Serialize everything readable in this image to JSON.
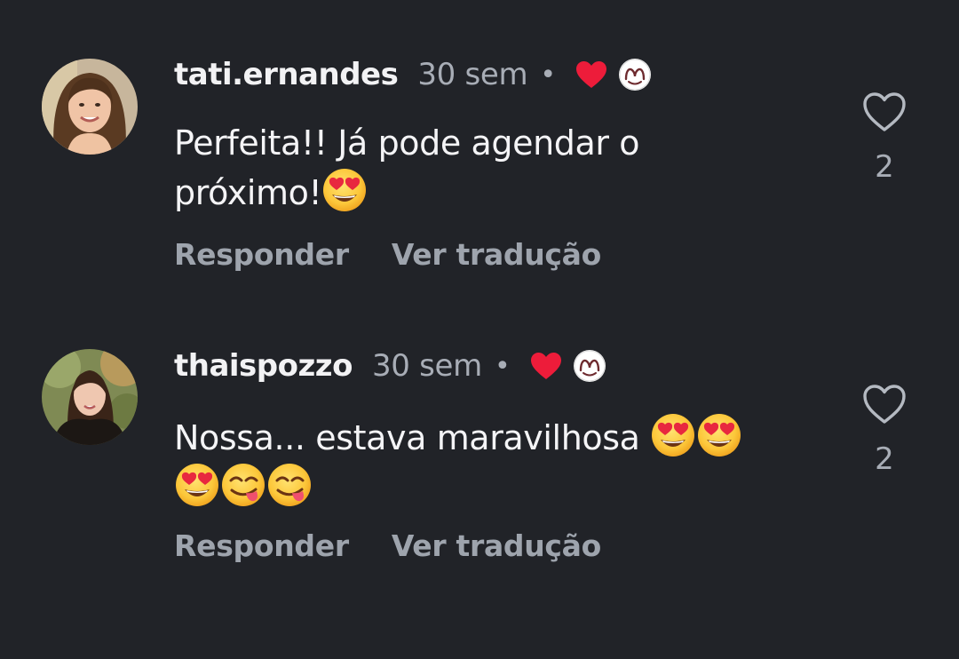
{
  "comments": [
    {
      "username": "tati.ernandes",
      "time": "30 sem",
      "separator": "•",
      "text_line1": "Perfeita!! Já pode agendar o",
      "text_line2": "próximo!",
      "text_emojis": [
        "heart-eyes"
      ],
      "reply_label": "Responder",
      "translate_label": "Ver tradução",
      "like_count": "2",
      "liked_by_author": true
    },
    {
      "username": "thaispozzo",
      "time": "30 sem",
      "separator": "•",
      "text_line1": "Nossa... estava maravilhosa",
      "text_emojis": [
        "heart-eyes",
        "heart-eyes",
        "heart-eyes",
        "yum",
        "yum"
      ],
      "reply_label": "Responder",
      "translate_label": "Ver tradução",
      "like_count": "2",
      "liked_by_author": true
    }
  ],
  "colors": {
    "background": "#212328",
    "liked_heart": "#ed1c3a",
    "muted_text": "#a8adb6",
    "emoji_yellow": "#fdc83a"
  },
  "icons": {
    "liked": "heart-filled-icon",
    "author_badge": "author-avatar-icon",
    "like_button": "heart-outline-icon"
  }
}
